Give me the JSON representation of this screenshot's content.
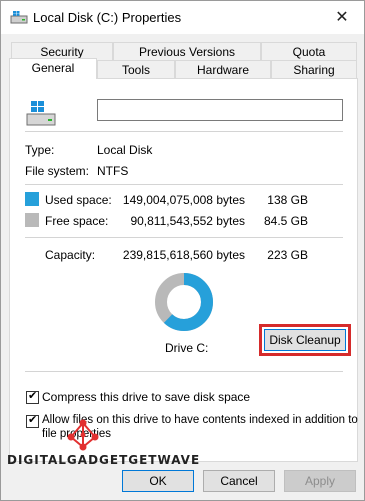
{
  "window": {
    "title": "Local Disk (C:) Properties",
    "close_glyph": "✕"
  },
  "tabs": {
    "row1": [
      {
        "label": "Security"
      },
      {
        "label": "Previous Versions"
      },
      {
        "label": "Quota"
      }
    ],
    "row2": [
      {
        "label": "General",
        "active": true
      },
      {
        "label": "Tools"
      },
      {
        "label": "Hardware"
      },
      {
        "label": "Sharing"
      }
    ]
  },
  "general": {
    "drive_name_value": "",
    "type_label": "Type:",
    "type_value": "Local Disk",
    "fs_label": "File system:",
    "fs_value": "NTFS",
    "used_label": "Used space:",
    "used_bytes": "149,004,075,008 bytes",
    "used_gb": "138 GB",
    "free_label": "Free space:",
    "free_bytes": "90,811,543,552 bytes",
    "free_gb": "84.5 GB",
    "capacity_label": "Capacity:",
    "capacity_bytes": "239,815,618,560 bytes",
    "capacity_gb": "223 GB",
    "drive_label": "Drive C:",
    "cleanup_button": "Disk Cleanup",
    "compress_label": "Compress this drive to save disk space",
    "compress_checked": true,
    "index_label_line1": "Allow files on this drive to have contents indexed in addition to",
    "index_label_line2": "file properties",
    "index_checked": true,
    "used_fraction": 0.621
  },
  "colors": {
    "used": "#26a0da",
    "free": "#b9b9b9",
    "highlight": "#d52b2b"
  },
  "buttons": {
    "ok": "OK",
    "cancel": "Cancel",
    "apply": "Apply"
  },
  "watermark": {
    "text": "DIGITALGADGETGETWAVE"
  },
  "icons": {
    "title": "drive-icon",
    "close": "close-icon",
    "drive": "windows-drive-icon"
  }
}
